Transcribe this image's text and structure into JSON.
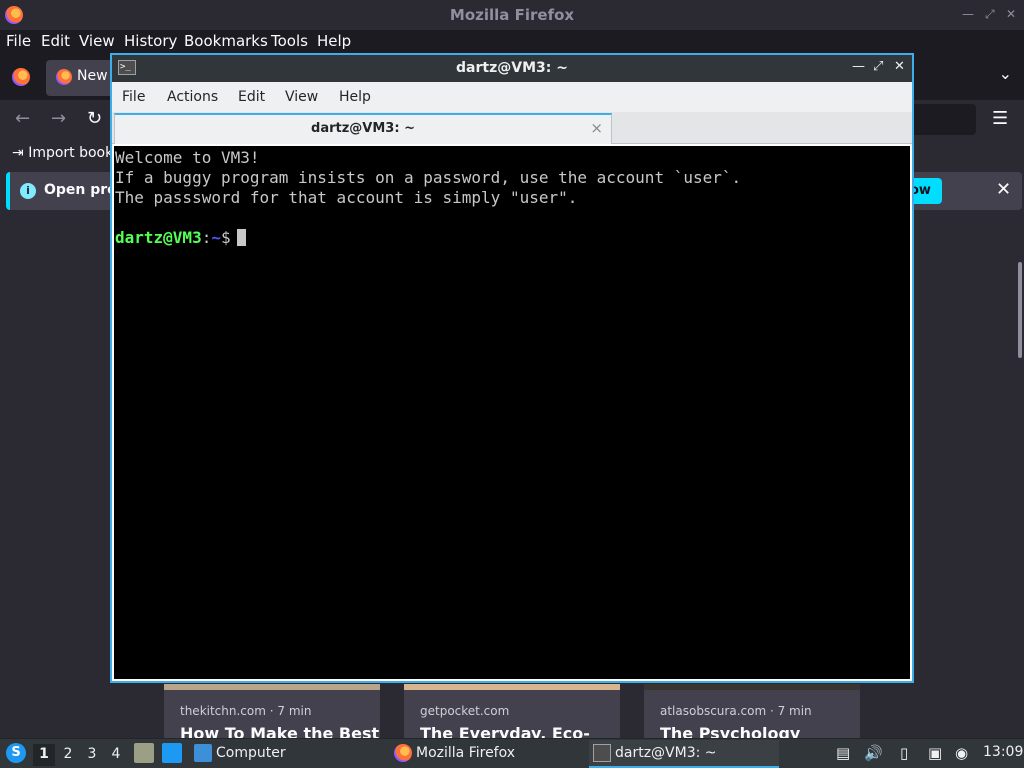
{
  "firefox": {
    "window_title": "Mozilla Firefox",
    "menu": [
      "File",
      "Edit",
      "View",
      "History",
      "Bookmarks",
      "Tools",
      "Help"
    ],
    "tab_label": "New",
    "bookmark_label": "Import book",
    "notice_text": "Open pre",
    "notice_button": "ow",
    "stories": [
      {
        "source": "thekitchn.com · 7 min",
        "title": "How To Make the Best"
      },
      {
        "source": "getpocket.com",
        "title": "The Everyday, Eco-"
      },
      {
        "source": "atlasobscura.com · 7 min",
        "title": "The Psychology"
      }
    ]
  },
  "terminal": {
    "window_title": "dartz@VM3: ~",
    "menu": [
      "File",
      "Actions",
      "Edit",
      "View",
      "Help"
    ],
    "tab_label": "dartz@VM3: ~",
    "tab_close": "×",
    "lines": [
      "Welcome to VM3!",
      "If a buggy program insists on a password, use the account `user`.",
      "The passsword for that account is simply \"user\"."
    ],
    "prompt_user": "dartz@VM3",
    "prompt_sep": ":",
    "prompt_path": "~",
    "prompt_symbol": "$"
  },
  "taskbar": {
    "desktops": [
      "1",
      "2",
      "3",
      "4"
    ],
    "active_desktop": "1",
    "tasks": [
      {
        "label": "Computer",
        "icon": "folder-icon"
      },
      {
        "label": "Mozilla Firefox",
        "icon": "firefox-icon"
      },
      {
        "label": "dartz@VM3: ~",
        "icon": "terminal-icon"
      }
    ],
    "clock": "13:09"
  },
  "colors": {
    "accent": "#3daee9",
    "prompt_user": "#54ff54",
    "prompt_path": "#5454ff",
    "notice_button": "#00ddff"
  }
}
